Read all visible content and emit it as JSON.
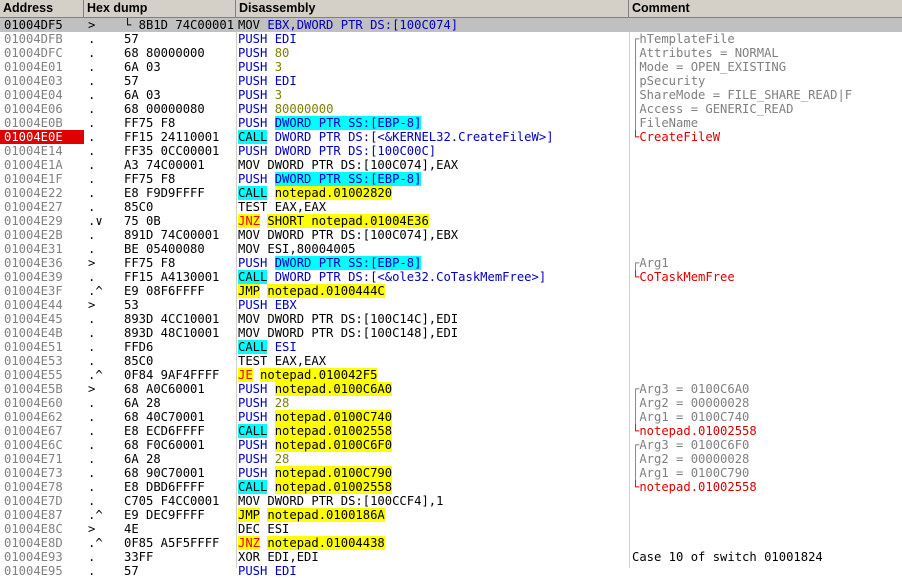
{
  "header": {
    "address": "Address",
    "hex": "Hex dump",
    "disasm": "Disassembly",
    "comment": "Comment"
  },
  "rows": [
    {
      "addr": "01004DF5",
      "arrow": ">",
      "hex": "└ 8B1D 74C00001",
      "mn": "MOV",
      "ops": "EBX,DWORD PTR DS:[100C074]",
      "comment": ""
    },
    {
      "addr": "01004DFB",
      "arrow": ".",
      "hex": "57",
      "mn": "PUSH",
      "ops": "EDI",
      "comment": "┌hTemplateFile"
    },
    {
      "addr": "01004DFC",
      "arrow": ".",
      "hex": "68 80000000",
      "mn": "PUSH",
      "ops": "80",
      "comment": "│Attributes = NORMAL"
    },
    {
      "addr": "01004E01",
      "arrow": ".",
      "hex": "6A 03",
      "mn": "PUSH",
      "ops": "3",
      "comment": "│Mode = OPEN_EXISTING"
    },
    {
      "addr": "01004E03",
      "arrow": ".",
      "hex": "57",
      "mn": "PUSH",
      "ops": "EDI",
      "comment": "│pSecurity"
    },
    {
      "addr": "01004E04",
      "arrow": ".",
      "hex": "6A 03",
      "mn": "PUSH",
      "ops": "3",
      "comment": "│ShareMode = FILE_SHARE_READ|F"
    },
    {
      "addr": "01004E06",
      "arrow": ".",
      "hex": "68 00000080",
      "mn": "PUSH",
      "ops": "80000000",
      "comment": "│Access = GENERIC_READ"
    },
    {
      "addr": "01004E0B",
      "arrow": ".",
      "hex": "FF75 F8",
      "mn": "PUSH",
      "ops": "DWORD PTR SS:[EBP-8]",
      "comment": "│FileName"
    },
    {
      "addr": "01004E0E",
      "arrow": ".",
      "hex": "FF15 24110001",
      "mn": "CALL",
      "ops": "DWORD PTR DS:[<&KERNEL32.CreateFileW>]",
      "comment": "└CreateFileW"
    },
    {
      "addr": "01004E14",
      "arrow": ".",
      "hex": "FF35 0CC00001",
      "mn": "PUSH",
      "ops": "DWORD PTR DS:[100C00C]",
      "comment": ""
    },
    {
      "addr": "01004E1A",
      "arrow": ".",
      "hex": "A3 74C00001",
      "mn": "MOV",
      "ops": "DWORD PTR DS:[100C074],EAX",
      "comment": ""
    },
    {
      "addr": "01004E1F",
      "arrow": ".",
      "hex": "FF75 F8",
      "mn": "PUSH",
      "ops": "DWORD PTR SS:[EBP-8]",
      "comment": ""
    },
    {
      "addr": "01004E22",
      "arrow": ".",
      "hex": "E8 F9D9FFFF",
      "mn": "CALL",
      "ops": "notepad.01002820",
      "comment": ""
    },
    {
      "addr": "01004E27",
      "arrow": ".",
      "hex": "85C0",
      "mn": "TEST",
      "ops": "EAX,EAX",
      "comment": ""
    },
    {
      "addr": "01004E29",
      "arrow": ".∨",
      "hex": "75 0B",
      "mn": "JNZ",
      "ops": "SHORT notepad.01004E36",
      "comment": ""
    },
    {
      "addr": "01004E2B",
      "arrow": ".",
      "hex": "891D 74C00001",
      "mn": "MOV",
      "ops": "DWORD PTR DS:[100C074],EBX",
      "comment": ""
    },
    {
      "addr": "01004E31",
      "arrow": ".",
      "hex": "BE 05400080",
      "mn": "MOV",
      "ops": "ESI,80004005",
      "comment": ""
    },
    {
      "addr": "01004E36",
      "arrow": ">",
      "hex": "FF75 F8",
      "mn": "PUSH",
      "ops": "DWORD PTR SS:[EBP-8]",
      "comment": "┌Arg1"
    },
    {
      "addr": "01004E39",
      "arrow": ".",
      "hex": "FF15 A4130001",
      "mn": "CALL",
      "ops": "DWORD PTR DS:[<&ole32.CoTaskMemFree>]",
      "comment": "└CoTaskMemFree"
    },
    {
      "addr": "01004E3F",
      "arrow": ".^",
      "hex": "E9 08F6FFFF",
      "mn": "JMP",
      "ops": "notepad.0100444C",
      "comment": ""
    },
    {
      "addr": "01004E44",
      "arrow": ">",
      "hex": "53",
      "mn": "PUSH",
      "ops": "EBX",
      "comment": ""
    },
    {
      "addr": "01004E45",
      "arrow": ".",
      "hex": "893D 4CC10001",
      "mn": "MOV",
      "ops": "DWORD PTR DS:[100C14C],EDI",
      "comment": ""
    },
    {
      "addr": "01004E4B",
      "arrow": ".",
      "hex": "893D 48C10001",
      "mn": "MOV",
      "ops": "DWORD PTR DS:[100C148],EDI",
      "comment": ""
    },
    {
      "addr": "01004E51",
      "arrow": ".",
      "hex": "FFD6",
      "mn": "CALL",
      "ops": "ESI",
      "comment": ""
    },
    {
      "addr": "01004E53",
      "arrow": ".",
      "hex": "85C0",
      "mn": "TEST",
      "ops": "EAX,EAX",
      "comment": ""
    },
    {
      "addr": "01004E55",
      "arrow": ".^",
      "hex": "0F84 9AF4FFFF",
      "mn": "JE",
      "ops": "notepad.010042F5",
      "comment": ""
    },
    {
      "addr": "01004E5B",
      "arrow": ">",
      "hex": "68 A0C60001",
      "mn": "PUSH",
      "ops": "notepad.0100C6A0",
      "comment": "┌Arg3 = 0100C6A0"
    },
    {
      "addr": "01004E60",
      "arrow": ".",
      "hex": "6A 28",
      "mn": "PUSH",
      "ops": "28",
      "comment": "│Arg2 = 00000028"
    },
    {
      "addr": "01004E62",
      "arrow": ".",
      "hex": "68 40C70001",
      "mn": "PUSH",
      "ops": "notepad.0100C740",
      "comment": "│Arg1 = 0100C740"
    },
    {
      "addr": "01004E67",
      "arrow": ".",
      "hex": "E8 ECD6FFFF",
      "mn": "CALL",
      "ops": "notepad.01002558",
      "comment": "└notepad.01002558"
    },
    {
      "addr": "01004E6C",
      "arrow": ".",
      "hex": "68 F0C60001",
      "mn": "PUSH",
      "ops": "notepad.0100C6F0",
      "comment": "┌Arg3 = 0100C6F0"
    },
    {
      "addr": "01004E71",
      "arrow": ".",
      "hex": "6A 28",
      "mn": "PUSH",
      "ops": "28",
      "comment": "│Arg2 = 00000028"
    },
    {
      "addr": "01004E73",
      "arrow": ".",
      "hex": "68 90C70001",
      "mn": "PUSH",
      "ops": "notepad.0100C790",
      "comment": "│Arg1 = 0100C790"
    },
    {
      "addr": "01004E78",
      "arrow": ".",
      "hex": "E8 DBD6FFFF",
      "mn": "CALL",
      "ops": "notepad.01002558",
      "comment": "└notepad.01002558"
    },
    {
      "addr": "01004E7D",
      "arrow": ".",
      "hex": "C705 F4CC0001",
      "mn": "MOV",
      "ops": "DWORD PTR DS:[100CCF4],1",
      "comment": ""
    },
    {
      "addr": "01004E87",
      "arrow": ".^",
      "hex": "E9 DEC9FFFF",
      "mn": "JMP",
      "ops": "notepad.0100186A",
      "comment": ""
    },
    {
      "addr": "01004E8C",
      "arrow": ">",
      "hex": "4E",
      "mn": "DEC",
      "ops": "ESI",
      "comment": ""
    },
    {
      "addr": "01004E8D",
      "arrow": ".^",
      "hex": "0F85 A5F5FFFF",
      "mn": "JNZ",
      "ops": "notepad.01004438",
      "comment": ""
    },
    {
      "addr": "01004E93",
      "arrow": ".",
      "hex": "33FF",
      "mn": "XOR",
      "ops": "EDI,EDI",
      "comment": "Case 10 of switch 01001824"
    },
    {
      "addr": "01004E95",
      "arrow": ".",
      "hex": "57",
      "mn": "PUSH",
      "ops": "EDI",
      "comment": ""
    }
  ]
}
